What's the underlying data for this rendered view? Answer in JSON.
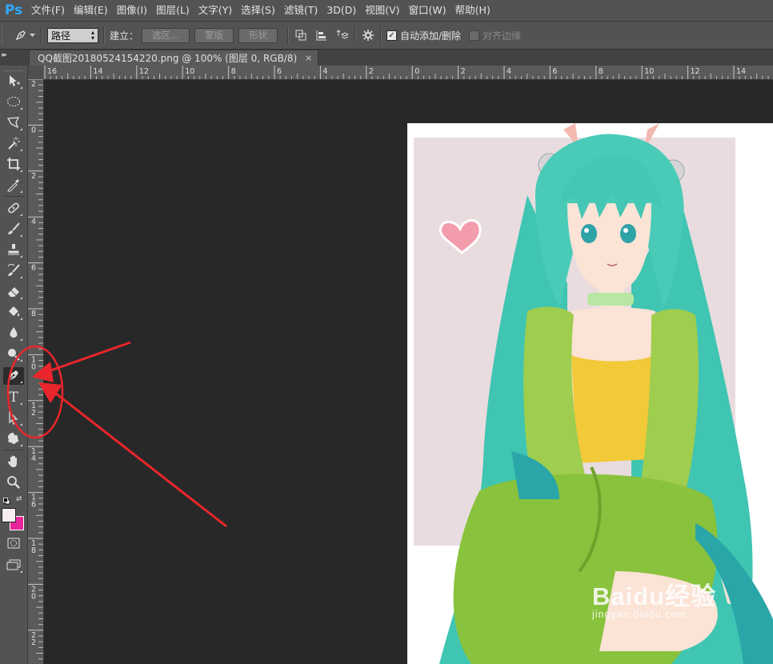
{
  "app": {
    "logo": "Ps"
  },
  "menu": [
    "文件(F)",
    "编辑(E)",
    "图像(I)",
    "图层(L)",
    "文字(Y)",
    "选择(S)",
    "滤镜(T)",
    "3D(D)",
    "视图(V)",
    "窗口(W)",
    "帮助(H)"
  ],
  "options_bar": {
    "tool_icon": "pen-icon",
    "mode_value": "路径",
    "build_label": "建立：",
    "selection_button": "选区...",
    "mask_button": "蒙版",
    "shape_button": "形状",
    "auto_add_delete_label": "自动添加/删除",
    "auto_add_delete_checked": true,
    "align_edges_label": "对齐边缘",
    "align_edges_checked": false
  },
  "document_tab": {
    "title": "QQ截图20180524154220.png @ 100% (图层 0, RGB/8)",
    "close": "×"
  },
  "rulers": {
    "horizontal": [
      "16",
      "14",
      "12",
      "10",
      "8",
      "6",
      "4",
      "2",
      "0",
      "2",
      "4",
      "6",
      "8",
      "10",
      "12",
      "14"
    ],
    "vertical": [
      "2",
      "0",
      "2",
      "4",
      "6",
      "8",
      "10",
      "12",
      "14",
      "16",
      "18",
      "20",
      "22"
    ]
  },
  "toolbar": {
    "tools": [
      "move-icon",
      "elliptical-marquee-icon",
      "lasso-icon",
      "magic-wand-icon",
      "crop-icon",
      "eyedropper-icon",
      "healing-brush-icon",
      "brush-icon",
      "clone-stamp-icon",
      "history-brush-icon",
      "eraser-icon",
      "paint-bucket-icon",
      "blur-icon",
      "dodge-icon",
      "pen-icon",
      "type-icon",
      "path-selection-icon",
      "custom-shape-icon",
      "hand-icon",
      "zoom-icon"
    ],
    "active_tool": "pen-icon",
    "type_tool_glyph": "T",
    "foreground_color": "#f6eef0",
    "background_color": "#e8259b"
  },
  "annotation": {
    "color": "#e8262b"
  },
  "watermark": {
    "brand": "Baidu经验",
    "url": "jingyan.baidu.com"
  }
}
